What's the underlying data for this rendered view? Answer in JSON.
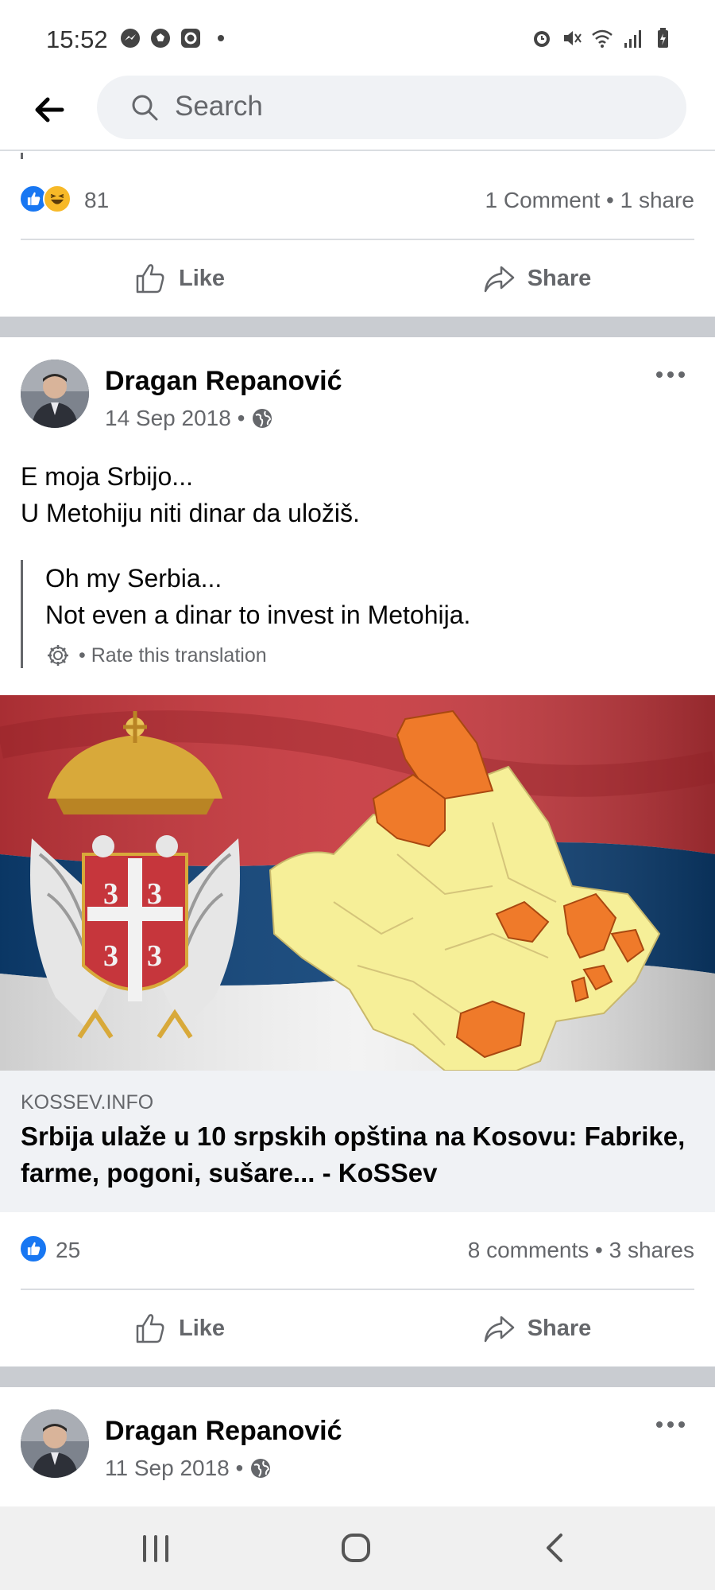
{
  "status_bar": {
    "time": "15:52",
    "left_icons": [
      "messenger-icon",
      "soccer-ball-icon",
      "app-icon",
      "notification-dot-icon"
    ],
    "right_icons": [
      "alarm-icon",
      "mute-icon",
      "wifi-icon",
      "signal-icon",
      "battery-icon"
    ]
  },
  "search": {
    "placeholder": "Search"
  },
  "post1_footer": {
    "reactions": [
      "like",
      "haha"
    ],
    "reaction_count": "81",
    "comments_shares": "1 Comment • 1 share",
    "like_label": "Like",
    "share_label": "Share"
  },
  "post2": {
    "author": "Dragan Repanović",
    "date": "14 Sep 2018 •",
    "audience_icon": "globe-icon",
    "text_line1": "E moja Srbijo...",
    "text_line2": "U Metohiju niti dinar da uložiš.",
    "translation_line1": "Oh my Serbia...",
    "translation_line2": "Not even a dinar to invest in Metohija.",
    "rate_translation": "• Rate this translation",
    "link_domain": "KOSSEV.INFO",
    "link_title": "Srbija ulaže u 10 srpskih opština na Kosovu: Fabrike, farme, pogoni, sušare... - KoSSev",
    "reaction_count": "25",
    "comments_shares": "8 comments • 3 shares",
    "like_label": "Like",
    "share_label": "Share"
  },
  "post3": {
    "author": "Dragan Repanović",
    "date": "11 Sep 2018 •"
  },
  "colors": {
    "like_blue": "#1877f2",
    "haha_yellow": "#f7b928",
    "secondary_text": "#65676b",
    "flag_red": "#c6363c",
    "flag_blue": "#0c4076",
    "map_yellow": "#f6ef98",
    "map_orange": "#ef7a2a"
  }
}
